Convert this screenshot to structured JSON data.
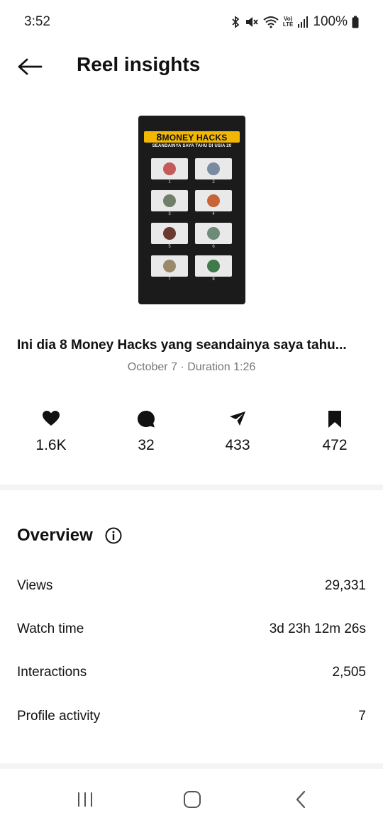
{
  "status_bar": {
    "time": "3:52",
    "volte_top": "Vo)",
    "volte_bottom": "LTE",
    "battery": "100%"
  },
  "header": {
    "title": "Reel insights"
  },
  "thumbnail": {
    "banner_number": "8",
    "banner_text": "MONEY HACKS",
    "subtitle": "SEANDAINYA SAYA TAHU DI USIA 20",
    "tile_numbers": [
      "1",
      "2",
      "3",
      "4",
      "5",
      "6",
      "7",
      "8"
    ]
  },
  "reel": {
    "caption": "Ini dia 8 Money Hacks yang seandainya saya tahu...",
    "meta": "October 7 · Duration 1:26"
  },
  "stats": {
    "likes": "1.6K",
    "comments": "32",
    "shares": "433",
    "saves": "472"
  },
  "overview": {
    "title": "Overview",
    "rows": [
      {
        "label": "Views",
        "value": "29,331"
      },
      {
        "label": "Watch time",
        "value": "3d 23h 12m 26s"
      },
      {
        "label": "Interactions",
        "value": "2,505"
      },
      {
        "label": "Profile activity",
        "value": "7"
      }
    ]
  },
  "colors": {
    "banner": "#f2b705",
    "text_primary": "#111111",
    "text_secondary": "#777777",
    "divider": "#f4f4f4"
  },
  "icons": [
    "back-arrow-icon",
    "heart-icon",
    "comment-icon",
    "share-icon",
    "bookmark-icon",
    "info-icon",
    "recents-icon",
    "home-icon",
    "nav-back-icon"
  ]
}
